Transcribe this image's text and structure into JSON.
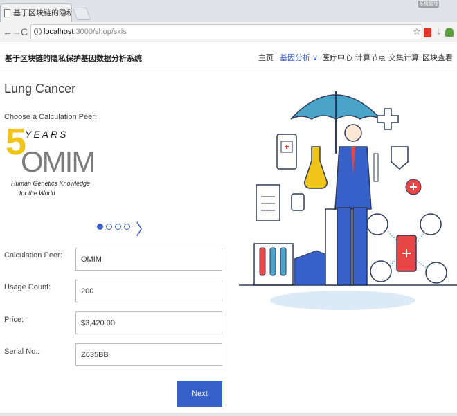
{
  "browser": {
    "tab_title": "基于区块链的隐私保",
    "tab_close": "×",
    "url_host": "localhost",
    "url_path": ":3000/shop/skis",
    "window_button": "系统管理"
  },
  "site": {
    "brand": "基于区块链的隐私保护基因数据分析系统",
    "menu": [
      {
        "label": "主页",
        "active": false
      },
      {
        "label": "基因分析 ∨",
        "active": true
      },
      {
        "label": "医疗中心",
        "active": false
      },
      {
        "label": "计算节点",
        "active": false
      },
      {
        "label": "交集计算",
        "active": false
      },
      {
        "label": "区块查看",
        "active": false
      }
    ]
  },
  "main": {
    "title": "Lung Cancer",
    "choose_label": "Choose a Calculation Peer:",
    "logo": {
      "five": "5",
      "years": "YEARS",
      "mim": "OMIM",
      "tagline_1": "Human Genetics Knowledge",
      "tagline_2": "for the World"
    },
    "carousel": {
      "dot_count": 4,
      "active_index": 0
    },
    "fields": [
      {
        "label": "Calculation Peer:",
        "value": "OMIM"
      },
      {
        "label": "Usage Count:",
        "value": "200"
      },
      {
        "label": "Price:",
        "value": "$3,420.00"
      },
      {
        "label": "Serial No.:",
        "value": "Z635BB"
      }
    ],
    "next_label": "Next"
  },
  "colors": {
    "accent": "#3761c8",
    "umbrella": "#4aa3c8",
    "logo_gold": "#f0c418"
  }
}
